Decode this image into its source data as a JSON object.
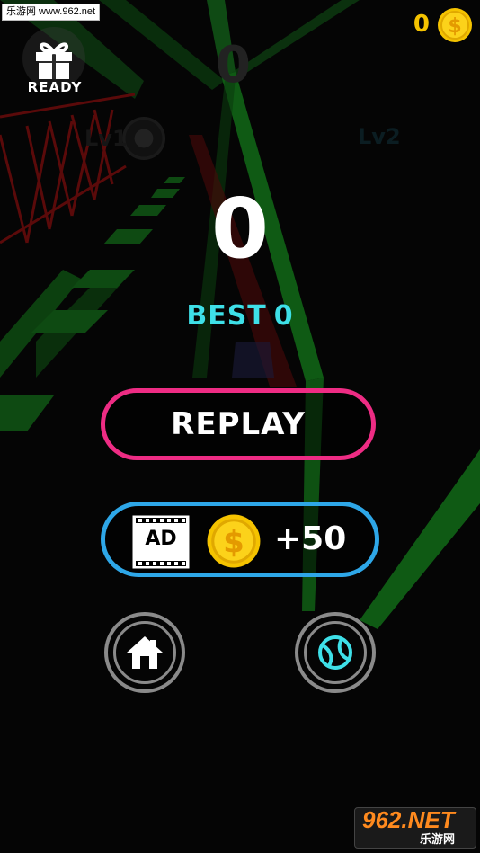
{
  "watermark_top": "乐游网 www.962.net",
  "gift": {
    "label": "READY"
  },
  "coins": {
    "count": "0",
    "icon": "dollar-coin-icon",
    "color": "#f5c300"
  },
  "background": {
    "faded_score": "0",
    "level_left": "Lv1",
    "level_right": "Lv2",
    "track_color": "#0f5a14",
    "rail_color": "#6a0a0a"
  },
  "score": {
    "value": "0"
  },
  "best": {
    "label": "BEST",
    "value": "0",
    "color": "#3ee0e8"
  },
  "replay_button": {
    "label": "REPLAY",
    "border_color": "#ee2c84"
  },
  "ad_button": {
    "ad_label": "AD",
    "reward": "+50",
    "border_color": "#2ea7e8"
  },
  "home_button": {
    "icon": "home-icon"
  },
  "ball_button": {
    "icon": "ball-icon"
  },
  "watermark_bottom": {
    "big": "962.NET",
    "small": "乐游网"
  }
}
